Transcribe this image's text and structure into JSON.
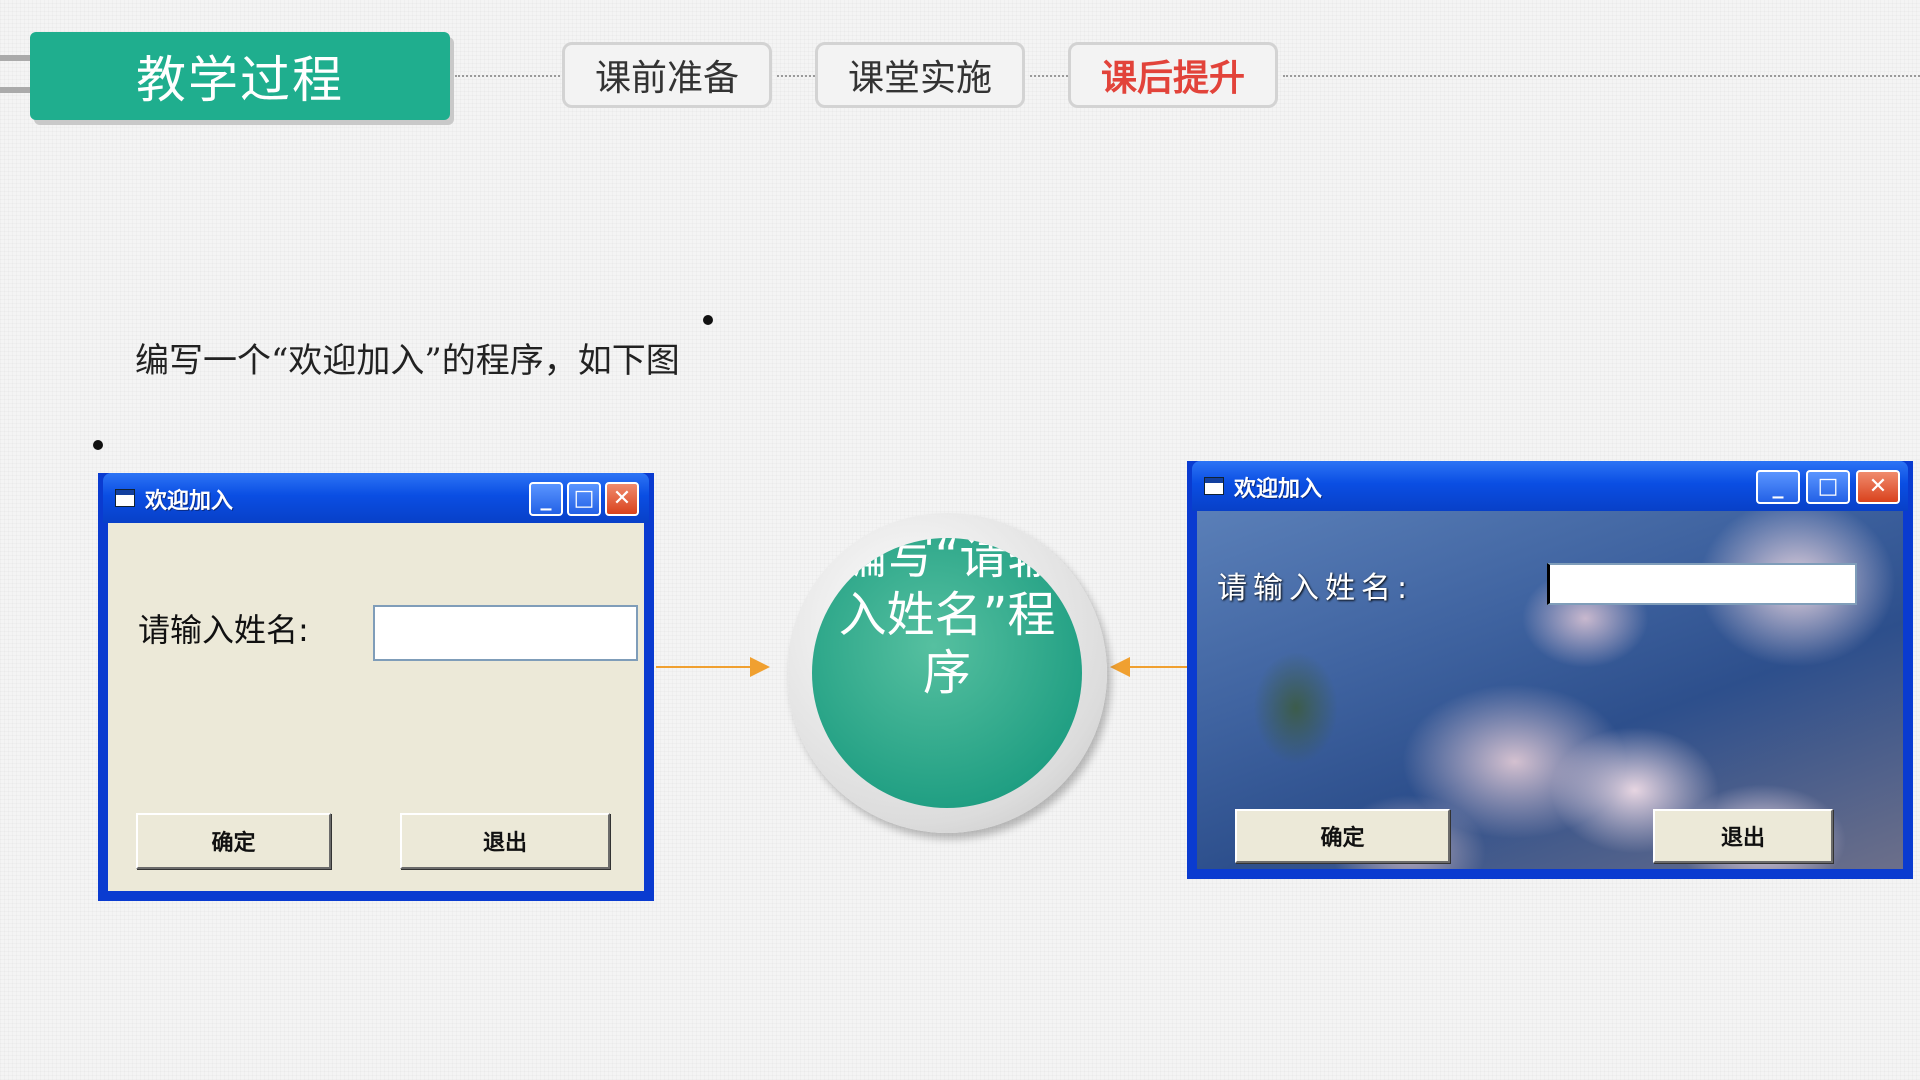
{
  "header": {
    "title": "教学过程",
    "tabs": [
      {
        "label": "课前准备",
        "active": false
      },
      {
        "label": "课堂实施",
        "active": false
      },
      {
        "label": "课后提升",
        "active": true
      }
    ]
  },
  "description": "编写一个“欢迎加入”的程序，如下图",
  "left_window": {
    "title": "欢迎加入",
    "prompt_label": "请输入姓名:",
    "name_value": "",
    "ok_label": "确定",
    "exit_label": "退出"
  },
  "center": {
    "text": "编写“请输入姓名”程序"
  },
  "right_window": {
    "title": "欢迎加入",
    "prompt_label": "请输入姓名:",
    "name_value": "",
    "ok_label": "确定",
    "exit_label": "退出"
  },
  "colors": {
    "accent_green": "#1fae8e",
    "active_tab_red": "#e2433a",
    "xp_blue": "#0a3bd0",
    "arrow_orange": "#f0a030"
  }
}
